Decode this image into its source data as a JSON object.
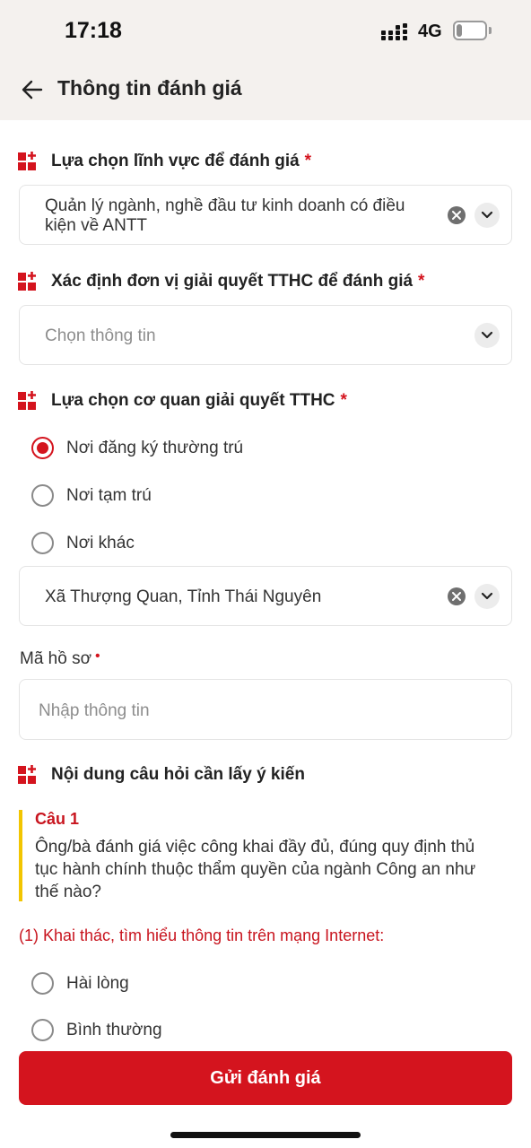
{
  "status_bar": {
    "time": "17:18",
    "network": "4G",
    "battery": "21",
    "battery_level": 0.21
  },
  "header": {
    "title": "Thông tin đánh giá"
  },
  "field_area": {
    "label": "Lựa chọn lĩnh vực để đánh giá",
    "required": "*",
    "value": "Quản lý ngành, nghề đầu tư kinh doanh có điều kiện về ANTT"
  },
  "field_unit": {
    "label": "Xác định đơn vị giải quyết TTHC để đánh giá",
    "required": "*",
    "placeholder": "Chọn thông tin"
  },
  "agency": {
    "label": "Lựa chọn cơ quan giải quyết TTHC",
    "required": "*",
    "options": [
      "Nơi đăng ký thường trú",
      "Nơi tạm trú",
      "Nơi khác"
    ],
    "selected": "Nơi đăng ký thường trú",
    "location_value": "Xã Thượng Quan, Tỉnh Thái Nguyên"
  },
  "file_code": {
    "label": "Mã hồ sơ",
    "required": "•",
    "placeholder": "Nhập thông tin"
  },
  "questions_section": {
    "label": "Nội dung câu hỏi cần lấy ý kiến",
    "question_number": "Câu 1",
    "question_text": "Ông/bà đánh giá việc công khai đầy đủ, đúng quy định thủ tục hành chính thuộc thẩm quyền của ngành Công an như thế nào?",
    "sub_question": "(1) Khai thác, tìm hiểu thông tin trên mạng Internet:",
    "answers": [
      "Hài lòng",
      "Bình thường"
    ]
  },
  "submit": {
    "label": "Gửi đánh giá"
  },
  "colors": {
    "accent": "#d4141e",
    "highlight_bar": "#f2c500",
    "header_bg": "#f4f1ee"
  },
  "icons": {
    "section": "grid-plus-icon",
    "back": "arrow-left-icon",
    "clear": "close-circle-icon",
    "dropdown": "chevron-down-icon"
  }
}
